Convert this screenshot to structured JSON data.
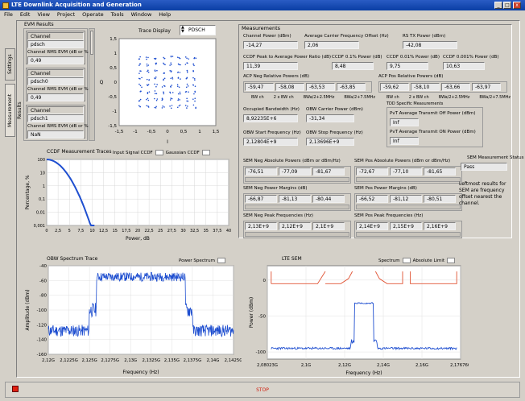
{
  "window": {
    "title": "LTE Downlink Acquisition and Generation",
    "min": "_",
    "max": "□",
    "close": "x"
  },
  "menu": [
    "File",
    "Edit",
    "View",
    "Project",
    "Operate",
    "Tools",
    "Window",
    "Help"
  ],
  "tabs": {
    "settings": "Settings",
    "results": "Measurement Results"
  },
  "evm": {
    "title": "EVM Results",
    "groups": [
      {
        "channel_label": "Channel",
        "channel": "pdsch",
        "rms_label": "Channel RMS EVM (dB or %)",
        "rms": "0,49"
      },
      {
        "channel_label": "Channel",
        "channel": "pdsch0",
        "rms_label": "Channel RMS EVM (dB or %)",
        "rms": "0,49"
      },
      {
        "channel_label": "Channel",
        "channel": "pdsch1",
        "rms_label": "Channel RMS EVM (dB or %)",
        "rms": "NaN"
      }
    ]
  },
  "constellation": {
    "display_label": "Trace Display",
    "display_value": "PDSCH",
    "xticks": [
      "-1,5",
      "-1",
      "-0,5",
      "0",
      "0,5",
      "1",
      "1,5"
    ],
    "yticks": [
      "1,5",
      "1",
      "0,5",
      "0",
      "-0,5",
      "-1",
      "-1,5"
    ],
    "xlabel": "I",
    "ylabel": "Q"
  },
  "measurements": {
    "title": "Measurements",
    "channel_power_label": "Channel Power (dBm)",
    "channel_power": "-14,27",
    "avg_cfo_label": "Average Carrier Frequency Offset (Hz)",
    "avg_cfo": "2,06",
    "rs_tx_label": "RS TX Power (dBm)",
    "rs_tx": "-42,08",
    "ccdf_par_label": "CCDF Peak to Average Power Ratio (dB)",
    "ccdf_par": "11,39",
    "ccdf01_label": "CCDF 0.1% Power (dB)",
    "ccdf01": "8,48",
    "ccdf001_label": "CCDF 0.01% Power (dB)",
    "ccdf001": "9,75",
    "ccdf0001_label": "CCDF 0.001% Power (dB)",
    "ccdf0001": "10,63",
    "acp_neg_label": "ACP Neg Relative Powers (dB)",
    "acp_neg": [
      "-59,47",
      "-58,08",
      "-63,53",
      "-63,85"
    ],
    "acp_pos_label": "ACP Pos Relative Powers (dB)",
    "acp_pos": [
      "-59,62",
      "-58,10",
      "-63,66",
      "-63,97"
    ],
    "acp_sub": [
      "BW ch",
      "2 x BW ch",
      "BWa/2+2.5MHz",
      "BWa/2+7.5MHz"
    ],
    "obw_label": "Occupied Bandwidth (Hz)",
    "obw": "8,92235E+6",
    "obw_cp_label": "OBW Carrier Power (dBm)",
    "obw_cp": "-31,34",
    "obw_start_label": "OBW Start Frequency (Hz)",
    "obw_start": "2,12804E+9",
    "obw_stop_label": "OBW Stop Frequency (Hz)",
    "obw_stop": "2,13696E+9",
    "tdd_title": "TDD Specific Measurements",
    "tdd_off_label": "PvT Average Transmit Off Power (dBm)",
    "tdd_off": "Inf",
    "tdd_on_label": "PvT Average Transmit ON Power (dBm)",
    "tdd_on": "Inf",
    "sem_neg_abs_label": "SEM Neg Absolute Powers (dBm or dBm/Hz)",
    "sem_neg_abs": [
      "-76,51",
      "-77,09",
      "-81,67"
    ],
    "sem_pos_abs_label": "SEM Pos Absolute Powers (dBm or dBm/Hz)",
    "sem_pos_abs": [
      "-72,67",
      "-77,10",
      "-81,65"
    ],
    "sem_neg_margin_label": "SEM Neg Power Margins (dB)",
    "sem_neg_margin": [
      "-66,87",
      "-81,13",
      "-80,44"
    ],
    "sem_pos_margin_label": "SEM Pos Power Margins (dB)",
    "sem_pos_margin": [
      "-66,52",
      "-81,12",
      "-80,51"
    ],
    "sem_neg_peak_label": "SEM Neg Peak Frequencies (Hz)",
    "sem_neg_peak": [
      "2,13E+9",
      "2,12E+9",
      "2,1E+9"
    ],
    "sem_pos_peak_label": "SEM Pos Peak Frequencies (Hz)",
    "sem_pos_peak": [
      "2,14E+9",
      "2,15E+9",
      "2,16E+9"
    ],
    "sem_status_label": "SEM Measurement Status",
    "sem_status": "Pass",
    "sem_note": "Leftmost results for SEM are frequency offset nearest the channel."
  },
  "ccdf": {
    "title": "CCDF Measurement Traces",
    "legend1": "Input Signal CCDF",
    "legend2": "Gaussian CCDF",
    "xlabel": "Power, dB",
    "ylabel": "Percentage, %",
    "yticks": [
      "100",
      "10",
      "1",
      "0,1",
      "0,01",
      "0,001"
    ],
    "xticks": [
      "0",
      "2,5",
      "5",
      "7,5",
      "10",
      "12,5",
      "15",
      "17,5",
      "20",
      "22,5",
      "25",
      "27,5",
      "30",
      "32,5",
      "35",
      "37,5",
      "40"
    ]
  },
  "obw_chart": {
    "title": "OBW Spectrum Trace",
    "legend": "Power Spectrum",
    "xlabel": "Frequency (Hz)",
    "ylabel": "Amplitude (dBm)",
    "yticks": [
      "-40",
      "-60",
      "-80",
      "-100",
      "-120",
      "-140",
      "-160"
    ],
    "xticks": [
      "2,12G",
      "2,1225G",
      "2,125G",
      "2,1275G",
      "2,13G",
      "2,1325G",
      "2,135G",
      "2,1375G",
      "2,14G",
      "2,1425G"
    ]
  },
  "sem_chart": {
    "title": "LTE SEM",
    "legend1": "Spectrum",
    "legend2": "Absolute Limit",
    "xlabel": "Frequency (Hz)",
    "ylabel": "Power (dBm)",
    "yticks": [
      "0",
      "-50",
      "-100"
    ],
    "xticks": [
      "2,08023G",
      "2,1G",
      "2,12G",
      "2,14G",
      "2,16G",
      "2,17676G"
    ]
  },
  "stop": {
    "label": "STOP"
  },
  "colors": {
    "trace": "#1f4fd0",
    "limit": "#e05030",
    "stop": "#e02010"
  }
}
